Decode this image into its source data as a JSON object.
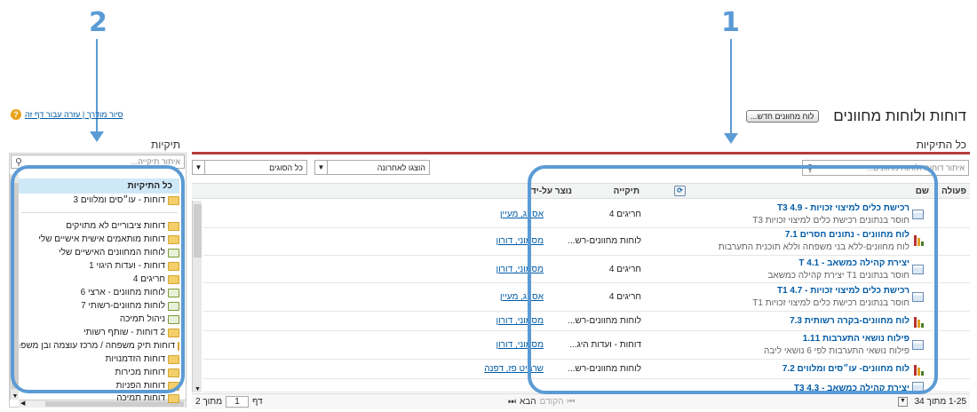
{
  "callouts": [
    "1",
    "2"
  ],
  "header": {
    "title": "דוחות ולוחות מחוונים",
    "new_dashboard_button": "לוח מחוונים חדש...",
    "help_links": "סיור מודרך | עזרה עבור דף זה",
    "help_icon": "help-circle-icon"
  },
  "main": {
    "section_title": "כל התיקיות",
    "search_placeholder": "איתור דוחות ולוחות מחוונים...",
    "filter_types": "כל הסוגים",
    "filter_recent": "הוצגו לאחרונה",
    "columns": [
      "פעולה",
      "שם",
      "תיקייה",
      "נוצר על-ידי"
    ],
    "rows": [
      {
        "type": "report",
        "title": "רכישת כלים למיצוי זכויות - T3 4.9",
        "subtitle": "חוסר בנתונים רכישת כלים למיצוי זכויות T3",
        "folder": "חריגים 4",
        "owner": "אס״ג, מעיין"
      },
      {
        "type": "dashboard",
        "title": "לוח מחוונים - נתונים חסרים 7.1",
        "subtitle": "לוח מחוונים-ללא בני משפחה וללא תוכנית התערבות",
        "folder": "לוחות מחוונים-רש...",
        "owner": "מסמוני, דורון"
      },
      {
        "type": "report",
        "title": "יצירת קהילה כמשאב - T 4.1",
        "subtitle": "חוסר בנתונים T1 יצירת קהילה כמשאב",
        "folder": "חריגים 4",
        "owner": "מסמוני, דורון"
      },
      {
        "type": "report",
        "title": "רכישת כלים למיצוי זכויות - T1 4.7",
        "subtitle": "חוסר בנתונים רכישת כלים למיצוי זכויות T1",
        "folder": "חריגים 4",
        "owner": "אס״ג, מעיין"
      },
      {
        "type": "dashboard",
        "title": "לוח מחוונים-בקרה רשותית 7.3",
        "subtitle": "",
        "folder": "לוחות מחוונים-רש...",
        "owner": "מסמוני, דורון"
      },
      {
        "type": "report",
        "title": "פילוח נושאי התערבות 1.11",
        "subtitle": "פילוח נושאי התערבות לפי 6 נושאי ליבה",
        "folder": "דוחות - ועדות היג...",
        "owner": "מסמוני, דורון"
      },
      {
        "type": "dashboard",
        "title": "לוח מחוונים- עו״סים ומלווים 7.2",
        "subtitle": "",
        "folder": "לוחות מחוונים-רש...",
        "owner": "שרביט פז, דפנה"
      },
      {
        "type": "report",
        "title": "יצירת קהילה כמשאב - T3 4.3",
        "subtitle": "",
        "folder": "",
        "owner": ""
      }
    ],
    "pagination": {
      "range": "1-25 מתוך 34",
      "prev": "הקודם",
      "next": "הבא",
      "page_label": "דף",
      "page_value": "1",
      "of_pages": "מתוך 2"
    }
  },
  "sidebar": {
    "title": "תיקיות",
    "search_placeholder": "איתור תיקייה...",
    "all_folders": "כל התיקיות",
    "items": [
      {
        "label": "דוחות - עו״סים ומלווים 3",
        "kind": "folder"
      },
      {
        "label": "דוחות ציבוריים לא מתויקים",
        "kind": "folder"
      },
      {
        "label": "דוחות מותאמים אישית אישיים שלי",
        "kind": "folder"
      },
      {
        "label": "לוחות המחוונים האישיים שלי",
        "kind": "dash"
      },
      {
        "label": "דוחות - ועדות היגוי 1",
        "kind": "folder"
      },
      {
        "label": "חריגים 4",
        "kind": "folder"
      },
      {
        "label": "לוחות מחוונים - ארצי 6",
        "kind": "dash"
      },
      {
        "label": "לוחות מחוונים-רשותי 7",
        "kind": "dash"
      },
      {
        "label": "ניהול תמיכה",
        "kind": "dash"
      },
      {
        "label": "2 דוחות - שותף רשותי",
        "kind": "folder"
      },
      {
        "label": "דוחות תיק משפחה / מרכז עוצמה ובן משפחה",
        "kind": "folder"
      },
      {
        "label": "דוחות הזדמנויות",
        "kind": "folder"
      },
      {
        "label": "דוחות מכירות",
        "kind": "folder"
      },
      {
        "label": "דוחות הפניות",
        "kind": "folder"
      },
      {
        "label": "דוחות תמיכה",
        "kind": "folder"
      }
    ]
  },
  "colors": {
    "accent": "#5b9bd5",
    "link": "#015ba7",
    "header_rule": "#b43c3c"
  }
}
